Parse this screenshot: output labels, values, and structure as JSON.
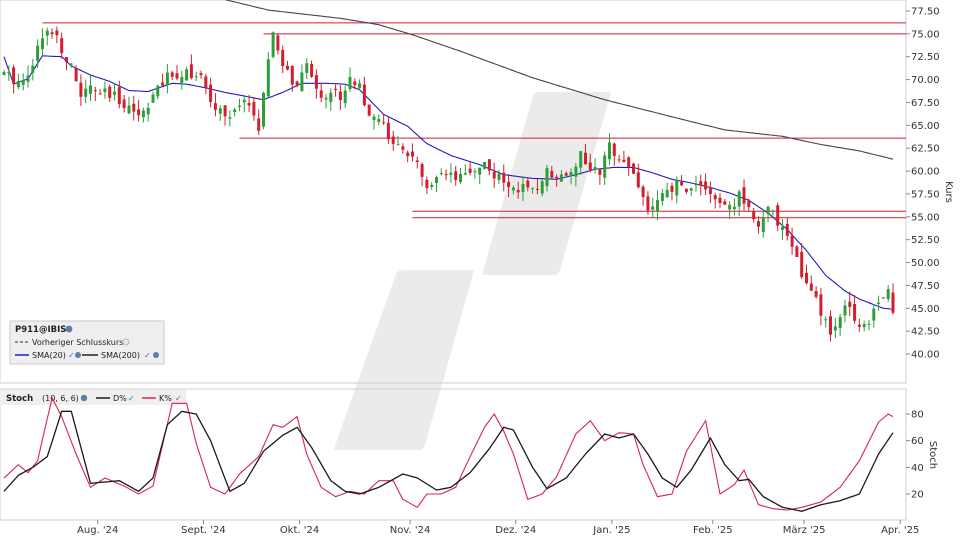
{
  "chart_data": [
    {
      "type": "candlestick",
      "symbol": "P911@IBIS",
      "y_axis_label": "Kurs",
      "ylim": [
        36.5,
        78.5
      ],
      "y_ticks": [
        "40.00",
        "42.50",
        "45.00",
        "47.50",
        "50.00",
        "52.50",
        "55.00",
        "57.50",
        "60.00",
        "62.50",
        "65.00",
        "67.50",
        "70.00",
        "72.50",
        "75.00",
        "77.50"
      ],
      "x_ticks": [
        "Aug. '24",
        "Sept. '24",
        "Okt. '24",
        "Nov. '24",
        "Dez. '24",
        "Jan. '25",
        "Feb. '25",
        "März '25",
        "Apr. '25"
      ],
      "legend": {
        "title": "P911@IBIS",
        "items": [
          "Vorheriger Schlusskurs",
          "SMA(20)",
          "SMA(200)"
        ]
      },
      "colors": {
        "up": "#2e9e3a",
        "down": "#d21e2e",
        "sma20": "#1f1fbf",
        "sma200": "#444444",
        "levels": "#d21e2e",
        "watermark": "#e8e8e8"
      },
      "horizontal_levels": [
        {
          "value": 76.2,
          "from_day": 8
        },
        {
          "value": 75.0,
          "from_day": 54
        },
        {
          "value": 63.6,
          "from_day": 49
        },
        {
          "value": 55.6,
          "from_day": 85
        },
        {
          "value": 54.9,
          "from_day": 85
        }
      ],
      "close_anchors": [
        [
          0,
          70.5
        ],
        [
          4,
          69.8
        ],
        [
          8,
          74.5
        ],
        [
          10,
          75.6
        ],
        [
          13,
          72.5
        ],
        [
          16,
          68.4
        ],
        [
          18,
          68.9
        ],
        [
          22,
          68.2
        ],
        [
          26,
          67.3
        ],
        [
          28,
          66.0
        ],
        [
          31,
          68.3
        ],
        [
          34,
          70.1
        ],
        [
          38,
          71.1
        ],
        [
          41,
          70.0
        ],
        [
          43,
          67.3
        ],
        [
          47,
          65.9
        ],
        [
          51,
          67.7
        ],
        [
          53,
          64.6
        ],
        [
          56,
          75.0
        ],
        [
          58,
          71.6
        ],
        [
          61,
          69.0
        ],
        [
          63,
          71.4
        ],
        [
          66,
          68.4
        ],
        [
          70,
          68.4
        ],
        [
          72,
          70.1
        ],
        [
          74,
          69.8
        ],
        [
          76,
          65.4
        ],
        [
          79,
          65.5
        ],
        [
          81,
          62.5
        ],
        [
          85,
          61.8
        ],
        [
          88,
          57.7
        ],
        [
          91,
          59.3
        ],
        [
          95,
          59.0
        ],
        [
          98,
          60.3
        ],
        [
          100,
          60.8
        ],
        [
          104,
          58.5
        ],
        [
          107,
          58.3
        ],
        [
          110,
          57.5
        ],
        [
          113,
          60.0
        ],
        [
          116,
          59.5
        ],
        [
          118,
          60.4
        ],
        [
          120,
          61.6
        ],
        [
          124,
          59.4
        ],
        [
          126,
          62.8
        ],
        [
          129,
          61.4
        ],
        [
          131,
          59.7
        ],
        [
          134,
          55.8
        ],
        [
          137,
          57.0
        ],
        [
          140,
          58.5
        ],
        [
          143,
          58.0
        ],
        [
          145,
          58.9
        ],
        [
          148,
          56.5
        ],
        [
          151,
          56.0
        ],
        [
          153,
          57.2
        ],
        [
          155,
          56.5
        ],
        [
          157,
          53.8
        ],
        [
          159,
          55.6
        ],
        [
          162,
          54.1
        ],
        [
          164,
          52.1
        ],
        [
          166,
          48.5
        ],
        [
          168,
          46.7
        ],
        [
          170,
          44.5
        ],
        [
          172,
          42.0
        ],
        [
          174,
          44.0
        ],
        [
          176,
          45.6
        ],
        [
          178,
          43.0
        ],
        [
          180,
          43.9
        ],
        [
          182,
          46.1
        ],
        [
          184,
          47.1
        ],
        [
          185,
          44.0
        ]
      ],
      "sma20_anchors": [
        [
          0,
          72.5
        ],
        [
          2,
          69.5
        ],
        [
          5,
          70.1
        ],
        [
          8,
          72.6
        ],
        [
          12,
          72.5
        ],
        [
          14,
          71.5
        ],
        [
          18,
          70.5
        ],
        [
          22,
          69.8
        ],
        [
          26,
          68.8
        ],
        [
          30,
          68.7
        ],
        [
          35,
          69.6
        ],
        [
          38,
          69.5
        ],
        [
          42,
          69.1
        ],
        [
          46,
          68.6
        ],
        [
          50,
          68.2
        ],
        [
          54,
          67.8
        ],
        [
          58,
          68.6
        ],
        [
          62,
          69.6
        ],
        [
          67,
          69.6
        ],
        [
          71,
          69.5
        ],
        [
          74,
          68.9
        ],
        [
          79,
          66.2
        ],
        [
          84,
          64.9
        ],
        [
          88,
          63.0
        ],
        [
          93,
          61.7
        ],
        [
          99,
          60.7
        ],
        [
          104,
          59.6
        ],
        [
          110,
          59.2
        ],
        [
          115,
          59.1
        ],
        [
          119,
          59.6
        ],
        [
          123,
          60.2
        ],
        [
          127,
          60.4
        ],
        [
          131,
          60.4
        ],
        [
          135,
          59.8
        ],
        [
          139,
          59.1
        ],
        [
          143,
          58.7
        ],
        [
          147,
          58.2
        ],
        [
          151,
          57.6
        ],
        [
          155,
          56.8
        ],
        [
          159,
          55.4
        ],
        [
          163,
          53.6
        ],
        [
          167,
          51.3
        ],
        [
          171,
          48.6
        ],
        [
          175,
          46.9
        ],
        [
          178,
          46.0
        ],
        [
          181,
          45.4
        ],
        [
          183,
          45.0
        ],
        [
          185,
          44.9
        ]
      ],
      "sma200_anchors": [
        [
          44,
          79.0
        ],
        [
          55,
          77.6
        ],
        [
          70,
          76.7
        ],
        [
          78,
          76.0
        ],
        [
          85,
          74.9
        ],
        [
          95,
          73.1
        ],
        [
          110,
          70.2
        ],
        [
          125,
          67.8
        ],
        [
          140,
          65.8
        ],
        [
          150,
          64.5
        ],
        [
          162,
          63.8
        ],
        [
          170,
          62.9
        ],
        [
          178,
          62.2
        ],
        [
          185,
          61.3
        ]
      ]
    },
    {
      "type": "line",
      "title": "Stoch",
      "params": "(10, 6, 6)",
      "y_axis_label": "Stoch",
      "ylim": [
        0,
        100
      ],
      "y_ticks": [
        "20",
        "40",
        "60",
        "80"
      ],
      "series": [
        {
          "name": "D%",
          "color": "#1a1a1a",
          "anchors": [
            [
              0,
              22
            ],
            [
              3,
              34
            ],
            [
              6,
              40
            ],
            [
              9,
              48
            ],
            [
              12,
              82
            ],
            [
              14,
              82
            ],
            [
              18,
              28
            ],
            [
              24,
              30
            ],
            [
              28,
              22
            ],
            [
              31,
              32
            ],
            [
              34,
              72
            ],
            [
              37,
              82
            ],
            [
              40,
              80
            ],
            [
              43,
              60
            ],
            [
              47,
              22
            ],
            [
              50,
              28
            ],
            [
              54,
              52
            ],
            [
              58,
              64
            ],
            [
              61,
              70
            ],
            [
              64,
              55
            ],
            [
              68,
              30
            ],
            [
              71,
              22
            ],
            [
              74,
              20
            ],
            [
              78,
              25
            ],
            [
              83,
              35
            ],
            [
              86,
              32
            ],
            [
              90,
              23
            ],
            [
              93,
              25
            ],
            [
              97,
              36
            ],
            [
              101,
              54
            ],
            [
              104,
              70
            ],
            [
              106,
              68
            ],
            [
              110,
              40
            ],
            [
              113,
              24
            ],
            [
              117,
              32
            ],
            [
              121,
              50
            ],
            [
              125,
              65
            ],
            [
              128,
              62
            ],
            [
              131,
              65
            ],
            [
              134,
              50
            ],
            [
              137,
              32
            ],
            [
              140,
              25
            ],
            [
              143,
              38
            ],
            [
              147,
              62
            ],
            [
              150,
              42
            ],
            [
              153,
              30
            ],
            [
              155,
              31
            ],
            [
              158,
              18
            ],
            [
              162,
              10
            ],
            [
              166,
              7
            ],
            [
              170,
              12
            ],
            [
              174,
              15
            ],
            [
              178,
              20
            ],
            [
              182,
              50
            ],
            [
              185,
              66
            ]
          ]
        },
        {
          "name": "K%",
          "color": "#d9254c",
          "anchors": [
            [
              0,
              32
            ],
            [
              3,
              42
            ],
            [
              5,
              36
            ],
            [
              7,
              45
            ],
            [
              10,
              92
            ],
            [
              12,
              78
            ],
            [
              15,
              50
            ],
            [
              18,
              25
            ],
            [
              21,
              32
            ],
            [
              25,
              26
            ],
            [
              28,
              20
            ],
            [
              31,
              26
            ],
            [
              35,
              88
            ],
            [
              38,
              88
            ],
            [
              40,
              58
            ],
            [
              43,
              25
            ],
            [
              46,
              20
            ],
            [
              49,
              35
            ],
            [
              53,
              48
            ],
            [
              56,
              72
            ],
            [
              58,
              70
            ],
            [
              61,
              78
            ],
            [
              63,
              50
            ],
            [
              66,
              25
            ],
            [
              69,
              18
            ],
            [
              72,
              22
            ],
            [
              75,
              20
            ],
            [
              78,
              30
            ],
            [
              81,
              30
            ],
            [
              83,
              16
            ],
            [
              86,
              10
            ],
            [
              88,
              20
            ],
            [
              91,
              20
            ],
            [
              94,
              25
            ],
            [
              97,
              48
            ],
            [
              100,
              70
            ],
            [
              102,
              80
            ],
            [
              104,
              67
            ],
            [
              106,
              50
            ],
            [
              109,
              16
            ],
            [
              112,
              20
            ],
            [
              115,
              33
            ],
            [
              119,
              65
            ],
            [
              122,
              75
            ],
            [
              125,
              60
            ],
            [
              128,
              66
            ],
            [
              131,
              65
            ],
            [
              133,
              42
            ],
            [
              136,
              18
            ],
            [
              139,
              20
            ],
            [
              142,
              52
            ],
            [
              146,
              75
            ],
            [
              149,
              20
            ],
            [
              152,
              27
            ],
            [
              154,
              38
            ],
            [
              157,
              12
            ],
            [
              160,
              9
            ],
            [
              163,
              8
            ],
            [
              166,
              10
            ],
            [
              170,
              14
            ],
            [
              174,
              25
            ],
            [
              178,
              45
            ],
            [
              182,
              74
            ],
            [
              184,
              80
            ],
            [
              185,
              78
            ]
          ]
        }
      ]
    }
  ]
}
